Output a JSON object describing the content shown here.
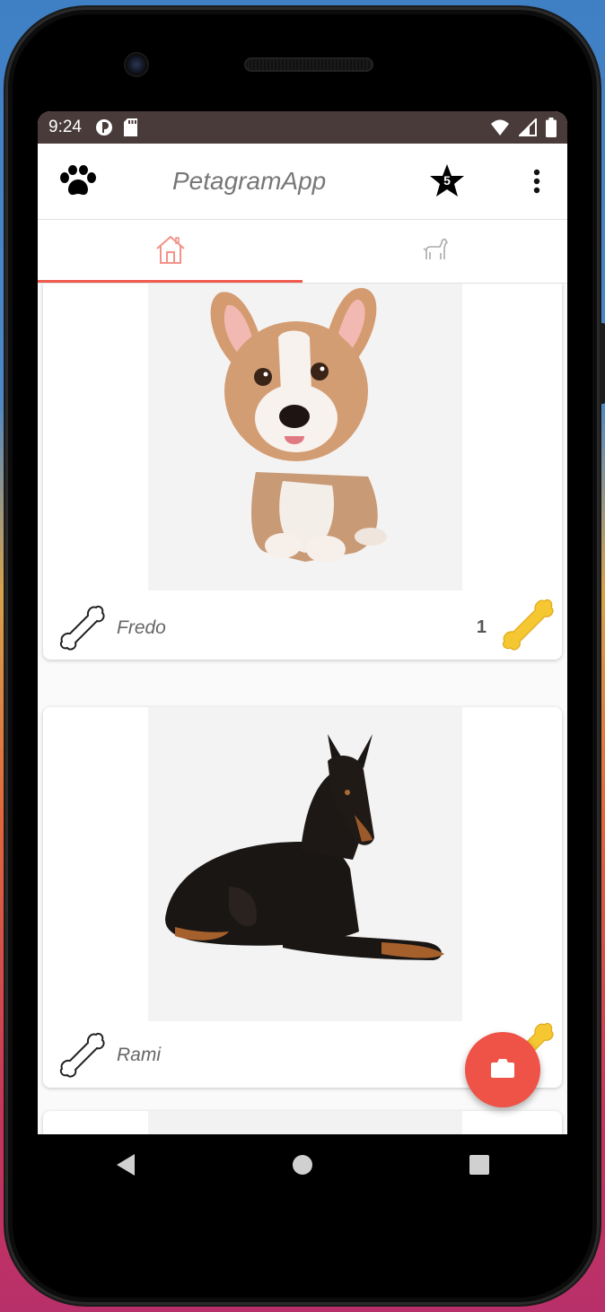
{
  "status_bar": {
    "time": "9:24"
  },
  "app_bar": {
    "title": "PetagramApp",
    "favorites_badge": "5",
    "icons": [
      "paw-icon",
      "star-icon",
      "more-vert-icon"
    ]
  },
  "tabs": [
    {
      "icon": "home-icon",
      "active": true
    },
    {
      "icon": "dog-icon",
      "active": false
    }
  ],
  "pets": [
    {
      "name": "Fredo",
      "likes": "1",
      "image": "corgi-puppy-illustration"
    },
    {
      "name": "Rami",
      "likes": "",
      "image": "doberman-illustration"
    }
  ],
  "fab": {
    "icon": "camera-icon"
  },
  "colors": {
    "accent": "#ef5a4d",
    "status_bar": "#4a3b3b",
    "bone_gold": "#f5c731"
  }
}
